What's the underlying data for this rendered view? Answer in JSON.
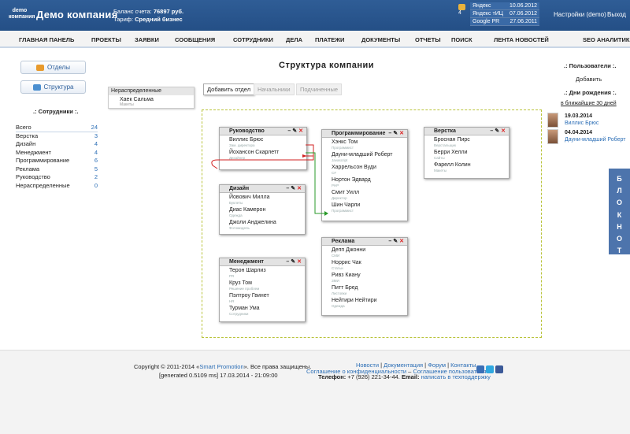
{
  "header": {
    "logo_small_1": "demo",
    "logo_small_2": "компания",
    "logo_title": "Демо компания",
    "balance_label": "Баланс счета:",
    "balance_value": "76897 руб.",
    "tariff_label": "Тариф:",
    "tariff_value": "Средний бизнес",
    "mail_count": "4",
    "stats": [
      {
        "label": "Яндекс",
        "value": "10.06.2012"
      },
      {
        "label": "Яндекс тИЦ",
        "value": "07.06.2012"
      },
      {
        "label": "Google PR",
        "value": "27.06.2011"
      }
    ],
    "settings": "Настройки (demo)",
    "logout": "Выход"
  },
  "nav": [
    "ГЛАВНАЯ ПАНЕЛЬ",
    "ПРОЕКТЫ",
    "ЗАЯВКИ",
    "СООБЩЕНИЯ",
    "СОТРУДНИКИ",
    "ДЕЛА",
    "ПЛАТЕЖИ",
    "ДОКУМЕНТЫ",
    "ОТЧЕТЫ",
    "ПОИСК",
    "ЛЕНТА НОВОСТЕЙ",
    "SEO АНАЛИТИКА"
  ],
  "left": {
    "btn_departments": "Отделы",
    "btn_structure": "Структура",
    "staff_title": ".: Сотрудники :.",
    "staff": [
      {
        "label": "Всего",
        "count": "24"
      },
      {
        "label": "Верстка",
        "count": "3"
      },
      {
        "label": "Дизайн",
        "count": "4"
      },
      {
        "label": "Менеджмент",
        "count": "4"
      },
      {
        "label": "Программирование",
        "count": "6"
      },
      {
        "label": "Реклама",
        "count": "5"
      },
      {
        "label": "Руководство",
        "count": "2"
      },
      {
        "label": "Нераспределенные",
        "count": "0"
      }
    ]
  },
  "main": {
    "title": "Структура компании",
    "unassigned": {
      "title": "Нераспределенные",
      "name": "Хаек Сальма",
      "position": "Макеты"
    },
    "tabs": [
      "Добавить отдел",
      "Начальники",
      "Подчиненные"
    ],
    "cards": [
      {
        "title": "Руководство",
        "members": [
          {
            "name": "Виллис Брюс",
            "position": "Зам. директора"
          },
          {
            "name": "Йохансон Скарлетт",
            "position": "Дизайнер"
          }
        ]
      },
      {
        "title": "Программирование",
        "members": [
          {
            "name": "Хэнкс Том",
            "position": "Программист"
          },
          {
            "name": "Дауни-младший Роберт",
            "position": "Javascript"
          },
          {
            "name": "Харрельсон Вуди",
            "position": "C#"
          },
          {
            "name": "Нортон Эдвард",
            "position": "PHP"
          },
          {
            "name": "Смит Уилл",
            "position": "Директор"
          },
          {
            "name": "Шин Чарли",
            "position": "Программист"
          }
        ]
      },
      {
        "title": "Верстка",
        "members": [
          {
            "name": "Броснан Пирс",
            "position": "Верстальщик"
          },
          {
            "name": "Берри Хелли",
            "position": "Сайты"
          },
          {
            "name": "Фарелл Колин",
            "position": "Макеты"
          }
        ]
      },
      {
        "title": "Дизайн",
        "members": [
          {
            "name": "Йовович Милла",
            "position": "Буклеты"
          },
          {
            "name": "Диас Камерон",
            "position": "Одежда"
          },
          {
            "name": "Джоли Анджелина",
            "position": "Фотомодель"
          }
        ]
      },
      {
        "title": "Реклама",
        "members": [
          {
            "name": "Депп Джонни",
            "position": "СМИ"
          },
          {
            "name": "Норрис Чак",
            "position": "Статьи"
          },
          {
            "name": "Ривз Киану",
            "position": "ЗМИ"
          },
          {
            "name": "Питт Бред",
            "position": "Листовки"
          },
          {
            "name": "Нейтири Нейтири",
            "position": "Одежда"
          }
        ]
      },
      {
        "title": "Менеджмент",
        "members": [
          {
            "name": "Терон Шарлиз",
            "position": "PR"
          },
          {
            "name": "Круз Том",
            "position": "Решение проблем"
          },
          {
            "name": "Пэлтроу Гвинет",
            "position": "HR"
          },
          {
            "name": "Турман Ума",
            "position": "Сотрудники"
          }
        ]
      }
    ]
  },
  "right": {
    "users_title": ".: Пользователи :.",
    "add_link": "Добавить",
    "bday_title": ".: Дни рождения :.",
    "bday_link": "в ближайшие 30 дней",
    "birthdays": [
      {
        "date": "19.03.2014",
        "name": "Виллис Брюс"
      },
      {
        "date": "04.04.2014",
        "name": "Дауни-младший Роберт"
      }
    ],
    "notepad": "БЛОКНОТ"
  },
  "footer": {
    "copyright_prefix": "Copyright © 2011-2014 «",
    "copyright_link": "Smart Promotion",
    "copyright_suffix": "». Все права защищены.",
    "generated": "[generated 0.5109 ms] 17.03.2014 - 21:09:00",
    "links1": [
      "Новости",
      "Документация",
      "Форум",
      "Контакты"
    ],
    "links2": [
      "Соглашение о конфиденциальности",
      "Соглашение пользователя"
    ],
    "phone_label": "Телефон:",
    "phone": "+7 (926) 221-34-44.",
    "email_label": "Email:",
    "email_link": "написать в техподдержку"
  },
  "colors": {
    "header": "#2a5890",
    "link": "#2a6db5",
    "delete": "#d22222",
    "arrow_red": "#d22222",
    "arrow_green": "#2a9a2a"
  }
}
